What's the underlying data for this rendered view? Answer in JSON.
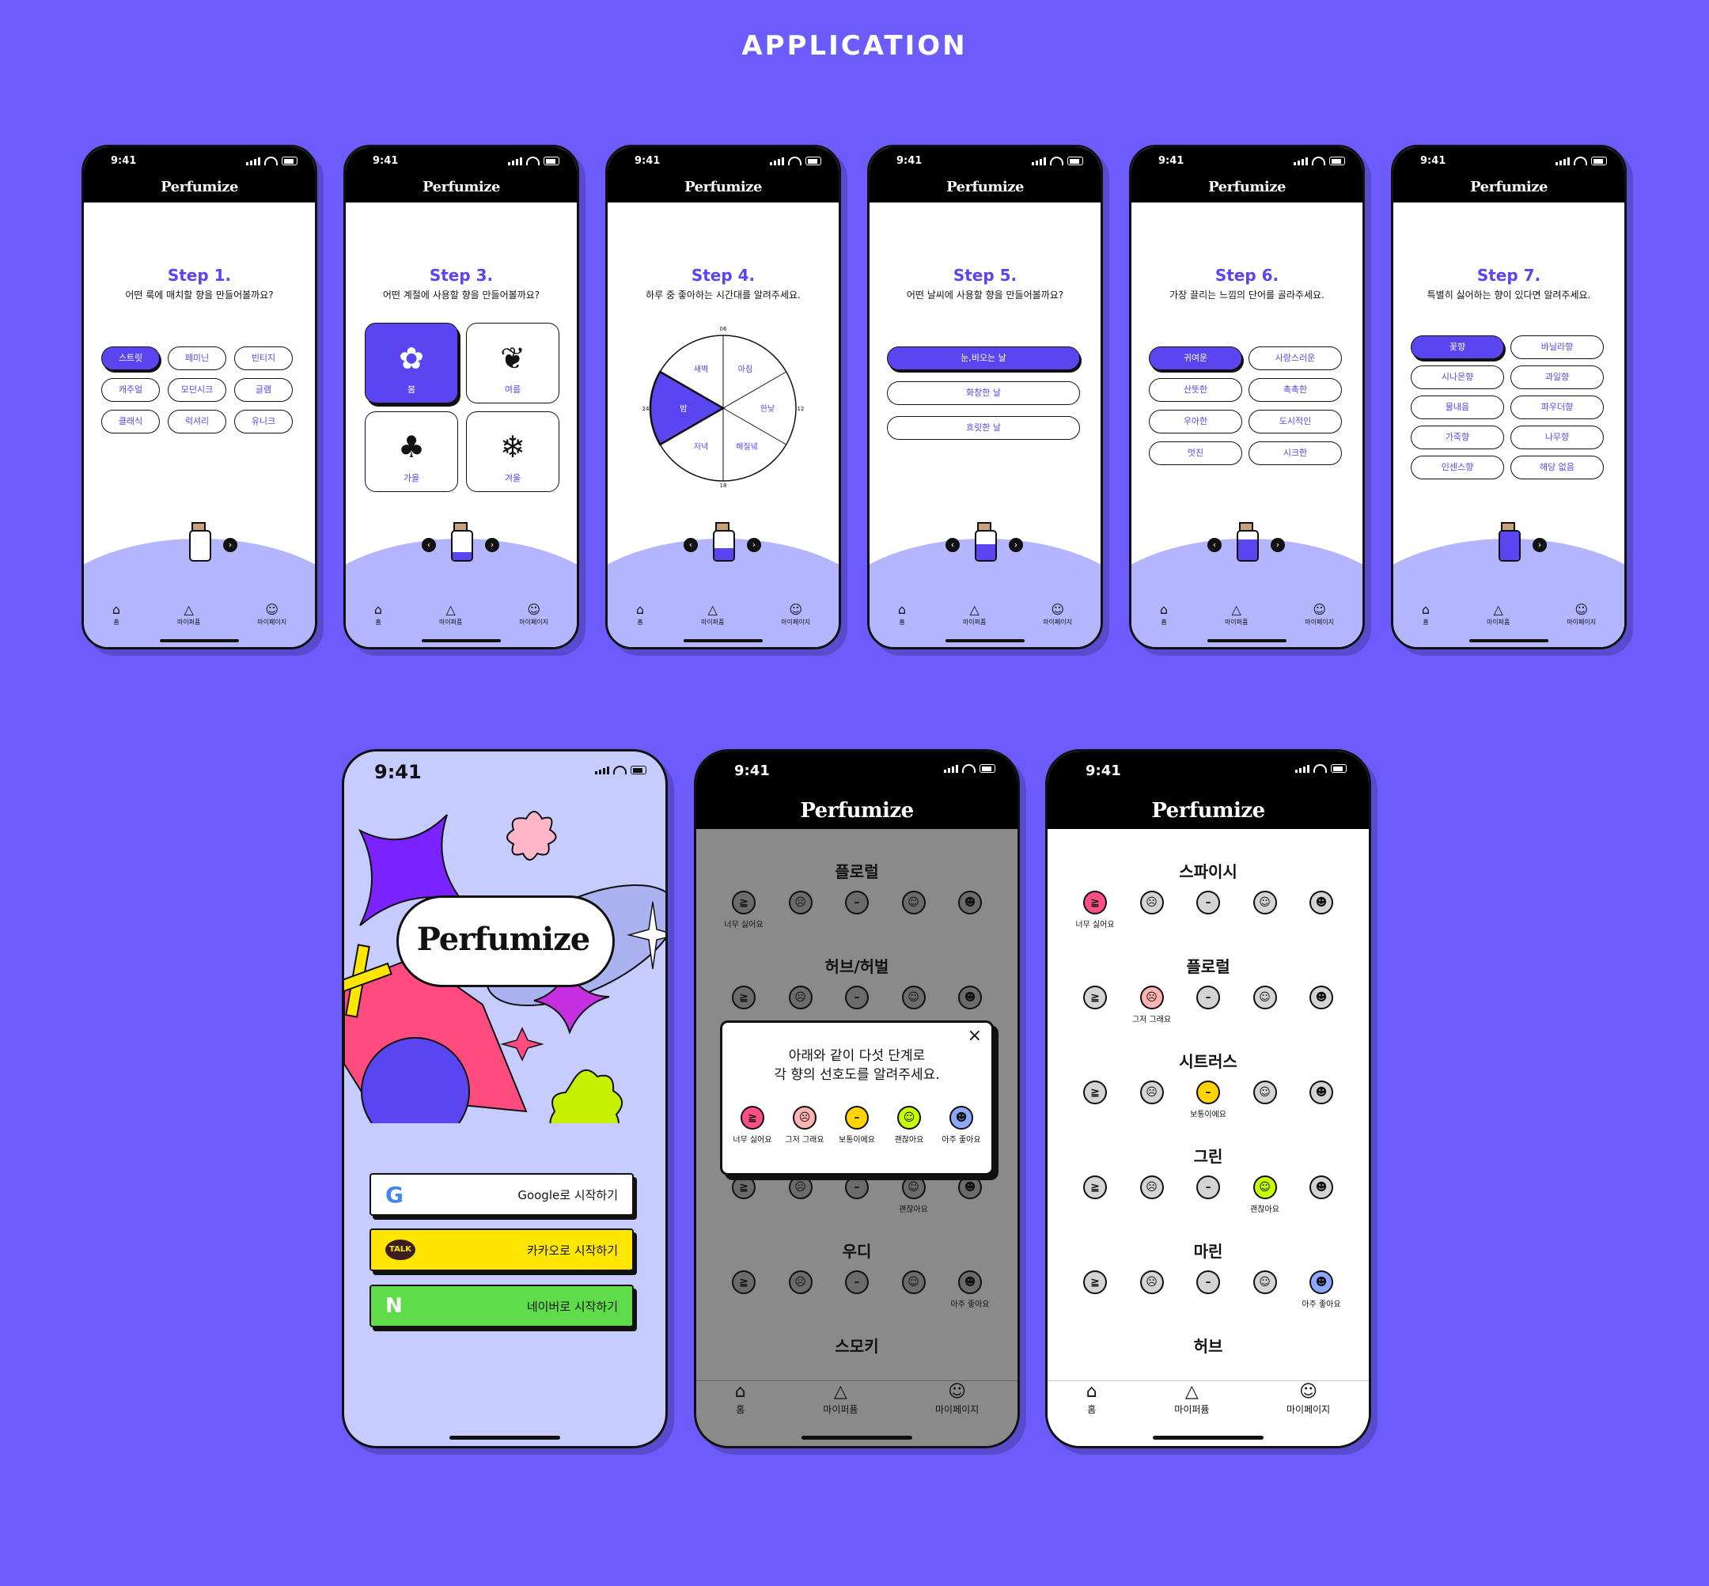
{
  "heading": "APPLICATION",
  "app": {
    "time": "9:41",
    "logo": "Perfumize"
  },
  "nav": {
    "home": "홈",
    "myperfume": "마이퍼퓸",
    "mypage": "마이페이지"
  },
  "steps": {
    "s1": {
      "title": "Step 1.",
      "question": "어떤 룩에 매치할 향을 만들어볼까요?",
      "options": [
        "스트릿",
        "페미닌",
        "빈티지",
        "캐주얼",
        "모던시크",
        "글램",
        "클래식",
        "럭셔리",
        "유니크"
      ],
      "selected": "스트릿"
    },
    "s3": {
      "title": "Step 3.",
      "question": "어떤 계절에 사용할 향을 만들어볼까요?",
      "options": [
        "봄",
        "여름",
        "가을",
        "겨울"
      ],
      "selected": "봄"
    },
    "s4": {
      "title": "Step 4.",
      "question": "하루 중 좋아하는 시간대를 알려주세요.",
      "slices": [
        "새벽",
        "아침",
        "한낮",
        "해질녘",
        "저녁",
        "밤"
      ],
      "selected": "밤",
      "ticks": [
        "06",
        "12",
        "18",
        "24"
      ]
    },
    "s5": {
      "title": "Step 5.",
      "question": "어떤 날씨에 사용할 향을 만들어볼까요?",
      "options": [
        "눈,비오는 날",
        "화창한 날",
        "흐릿한 날"
      ],
      "selected": "눈,비오는 날"
    },
    "s6": {
      "title": "Step 6.",
      "question": "가장 끌리는 느낌의 단어를 골라주세요.",
      "options": [
        "귀여운",
        "사랑스러운",
        "산뜻한",
        "촉촉한",
        "우아한",
        "도시적인",
        "멋진",
        "시크한"
      ],
      "selected": "귀여운"
    },
    "s7": {
      "title": "Step 7.",
      "question": "특별히 싫어하는 향이 있다면 알려주세요.",
      "options": [
        "꽃향",
        "바닐라향",
        "시나몬향",
        "과일향",
        "물내음",
        "파우더향",
        "가죽향",
        "나무향",
        "인센스향",
        "해당 없음"
      ],
      "selected": "꽃향"
    }
  },
  "login": {
    "google": "Google로 시작하기",
    "kakao": "카카오로 시작하기",
    "kakao_badge": "TALK",
    "naver": "네이버로 시작하기",
    "naver_badge": "N"
  },
  "ratings": {
    "labels": [
      "너무 싫어요",
      "그저 그래요",
      "보통이에요",
      "괜찮아요",
      "아주 좋아요"
    ],
    "modal_line1": "아래와 같이 다섯 단계로",
    "modal_line2": "각 향의 선호도를 알려주세요.",
    "dim_categories": [
      "플로럴",
      "허브/허벌",
      "우디",
      "스모키"
    ],
    "categories": [
      "스파이시",
      "플로럴",
      "시트러스",
      "그린",
      "마린",
      "허브"
    ],
    "colors": [
      "#ff4f86",
      "#ffb3b3",
      "#ffd400",
      "#c6ff00",
      "#8fa8ff"
    ]
  }
}
